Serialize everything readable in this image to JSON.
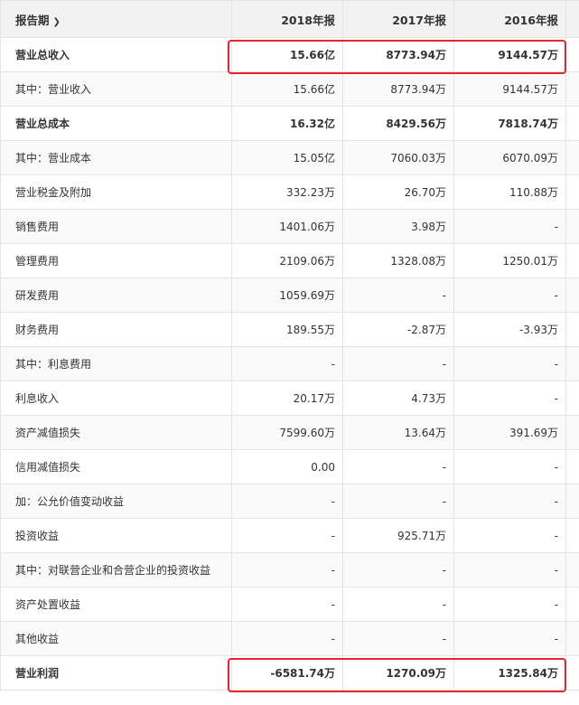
{
  "header": {
    "period_label": "报告期",
    "period_icon": "chevron-down-icon",
    "columns": [
      "2018年报",
      "2017年报",
      "2016年报"
    ]
  },
  "rows": [
    {
      "name": "营业总收入",
      "bold": true,
      "values": [
        "15.66亿",
        "8773.94万",
        "9144.57万"
      ]
    },
    {
      "name": "其中：营业收入",
      "bold": false,
      "values": [
        "15.66亿",
        "8773.94万",
        "9144.57万"
      ]
    },
    {
      "name": "营业总成本",
      "bold": true,
      "values": [
        "16.32亿",
        "8429.56万",
        "7818.74万"
      ]
    },
    {
      "name": "其中：营业成本",
      "bold": false,
      "values": [
        "15.05亿",
        "7060.03万",
        "6070.09万"
      ]
    },
    {
      "name": "营业税金及附加",
      "bold": false,
      "values": [
        "332.23万",
        "26.70万",
        "110.88万"
      ]
    },
    {
      "name": "销售费用",
      "bold": false,
      "values": [
        "1401.06万",
        "3.98万",
        "-"
      ]
    },
    {
      "name": "管理费用",
      "bold": false,
      "values": [
        "2109.06万",
        "1328.08万",
        "1250.01万"
      ]
    },
    {
      "name": "研发费用",
      "bold": false,
      "values": [
        "1059.69万",
        "-",
        "-"
      ]
    },
    {
      "name": "财务费用",
      "bold": false,
      "values": [
        "189.55万",
        "-2.87万",
        "-3.93万"
      ]
    },
    {
      "name": "其中：利息费用",
      "bold": false,
      "values": [
        "-",
        "-",
        "-"
      ]
    },
    {
      "name": "利息收入",
      "bold": false,
      "values": [
        "20.17万",
        "4.73万",
        "-"
      ]
    },
    {
      "name": "资产减值损失",
      "bold": false,
      "values": [
        "7599.60万",
        "13.64万",
        "391.69万"
      ]
    },
    {
      "name": "信用减值损失",
      "bold": false,
      "values": [
        "0.00",
        "-",
        "-"
      ]
    },
    {
      "name": "加：公允价值变动收益",
      "bold": false,
      "values": [
        "-",
        "-",
        "-"
      ]
    },
    {
      "name": "投资收益",
      "bold": false,
      "values": [
        "-",
        "925.71万",
        "-"
      ]
    },
    {
      "name": "其中：对联营企业和合营企业的投资收益",
      "bold": false,
      "values": [
        "-",
        "-",
        "-"
      ]
    },
    {
      "name": "资产处置收益",
      "bold": false,
      "values": [
        "-",
        "-",
        "-"
      ]
    },
    {
      "name": "其他收益",
      "bold": false,
      "values": [
        "-",
        "-",
        "-"
      ]
    },
    {
      "name": "营业利润",
      "bold": true,
      "values": [
        "-6581.74万",
        "1270.09万",
        "1325.84万"
      ]
    }
  ],
  "highlight_color": "#e8242c"
}
